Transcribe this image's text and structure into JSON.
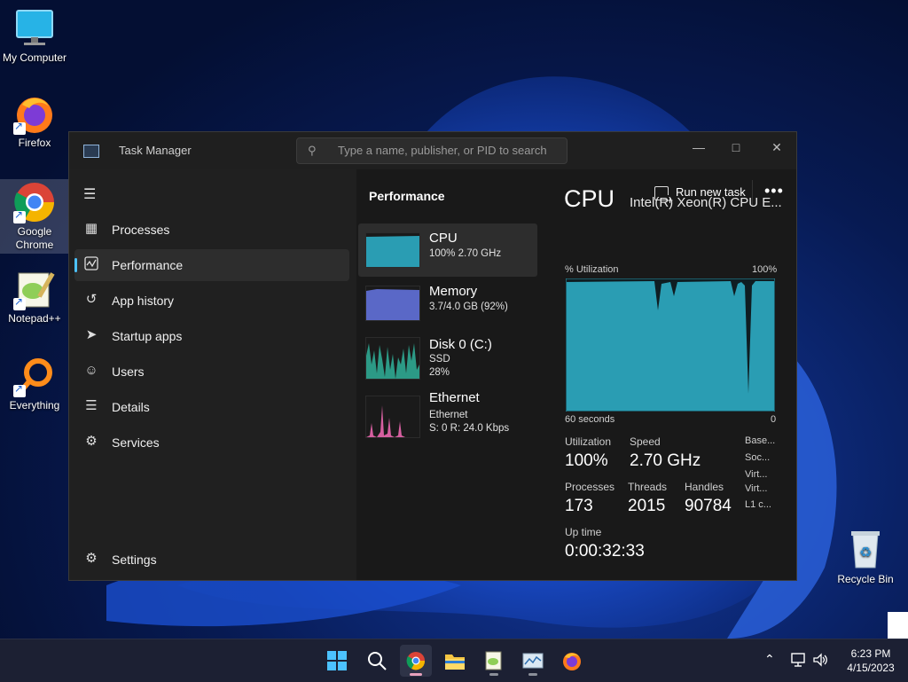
{
  "desktop": {
    "icons": [
      {
        "label": "My Computer"
      },
      {
        "label": "Firefox"
      },
      {
        "label": "Google Chrome"
      },
      {
        "label": "Notepad++"
      },
      {
        "label": "Everything"
      }
    ],
    "recycle_bin": "Recycle Bin"
  },
  "window": {
    "title": "Task Manager",
    "search_placeholder": "Type a name, publisher, or PID to search"
  },
  "sidebar": {
    "items": [
      {
        "label": "Processes",
        "icon": "processes-icon"
      },
      {
        "label": "Performance",
        "icon": "performance-icon",
        "active": true
      },
      {
        "label": "App history",
        "icon": "history-icon"
      },
      {
        "label": "Startup apps",
        "icon": "startup-icon"
      },
      {
        "label": "Users",
        "icon": "users-icon"
      },
      {
        "label": "Details",
        "icon": "details-icon"
      },
      {
        "label": "Services",
        "icon": "services-icon"
      }
    ],
    "settings_label": "Settings"
  },
  "header": {
    "title": "Performance",
    "run_new_task": "Run new task"
  },
  "devices": [
    {
      "name": "CPU",
      "sub1": "100%  2.70 GHz",
      "sub2": "",
      "active": true
    },
    {
      "name": "Memory",
      "sub1": "3.7/4.0 GB (92%)",
      "sub2": ""
    },
    {
      "name": "Disk 0 (C:)",
      "sub1": "SSD",
      "sub2": "28%"
    },
    {
      "name": "Ethernet",
      "sub1": "Ethernet",
      "sub2": "S: 0 R: 24.0 Kbps"
    }
  ],
  "detail": {
    "title": "CPU",
    "model": "Intel(R) Xeon(R) CPU E...",
    "graph_label": "% Utilization",
    "graph_max": "100%",
    "graph_time": "60 seconds",
    "graph_min": "0",
    "utilization_label": "Utilization",
    "utilization": "100%",
    "speed_label": "Speed",
    "speed": "2.70 GHz",
    "processes_label": "Processes",
    "processes": "173",
    "threads_label": "Threads",
    "threads": "2015",
    "handles_label": "Handles",
    "handles": "90784",
    "uptime_label": "Up time",
    "uptime": "0:00:32:33",
    "side_labels": [
      "Base...",
      "Soc...",
      "Virt...",
      "Virt...",
      "L1 c..."
    ]
  },
  "taskbar": {
    "time": "6:23 PM",
    "date": "4/15/2023"
  },
  "colors": {
    "accent": "#4cc2ff",
    "cpu_graph": "#2a9db3",
    "memory_graph": "#5a68c7",
    "ethernet_graph": "#d65fa0"
  }
}
